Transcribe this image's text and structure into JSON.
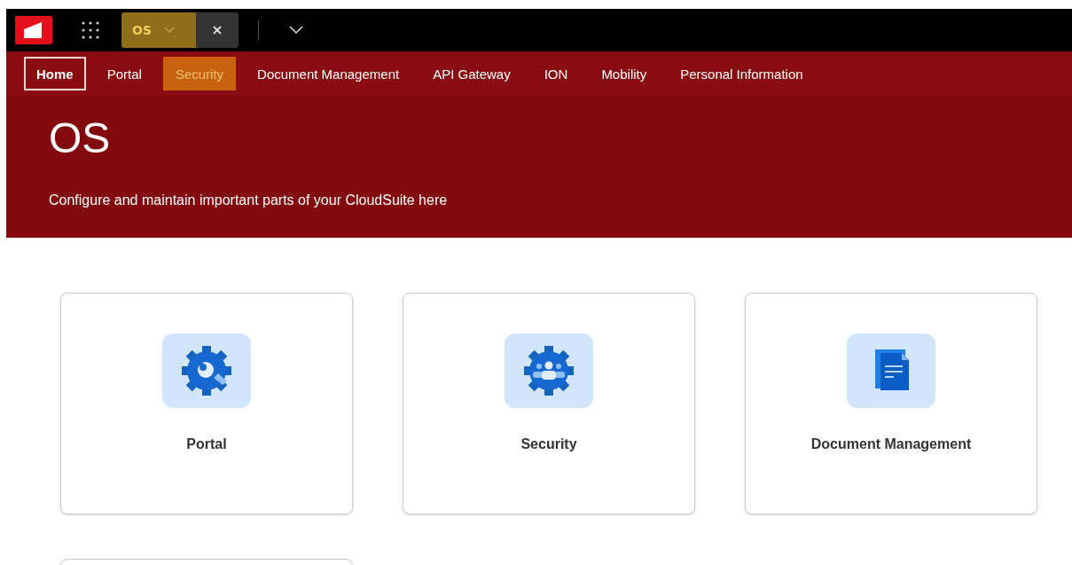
{
  "topbar": {
    "tab": {
      "label": "OS",
      "selected": true
    }
  },
  "nav": [
    {
      "label": "Home",
      "selected": true,
      "highlighted": false
    },
    {
      "label": "Portal",
      "selected": false,
      "highlighted": false
    },
    {
      "label": "Security",
      "selected": false,
      "highlighted": true
    },
    {
      "label": "Document Management",
      "selected": false,
      "highlighted": false
    },
    {
      "label": "API Gateway",
      "selected": false,
      "highlighted": false
    },
    {
      "label": "ION",
      "selected": false,
      "highlighted": false
    },
    {
      "label": "Mobility",
      "selected": false,
      "highlighted": false
    },
    {
      "label": "Personal Information",
      "selected": false,
      "highlighted": false
    }
  ],
  "banner": {
    "title": "OS",
    "subtitle": "Configure and maintain important parts of your CloudSuite here"
  },
  "cards": [
    {
      "kind": "wrench",
      "label": "Portal"
    },
    {
      "kind": "people",
      "label": "Security"
    },
    {
      "kind": "document",
      "label": "Document Management"
    },
    {
      "kind": "blank"
    }
  ]
}
